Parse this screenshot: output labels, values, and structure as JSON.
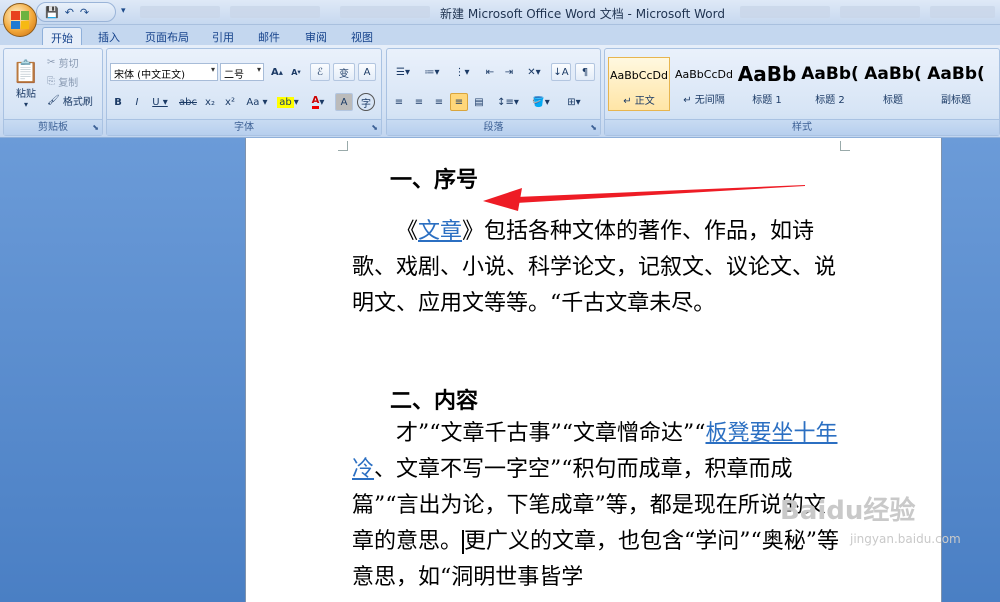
{
  "window": {
    "title": "新建 Microsoft Office Word 文档 - Microsoft Word"
  },
  "tabs": [
    {
      "label": "开始"
    },
    {
      "label": "插入"
    },
    {
      "label": "页面布局"
    },
    {
      "label": "引用"
    },
    {
      "label": "邮件"
    },
    {
      "label": "审阅"
    },
    {
      "label": "视图"
    }
  ],
  "clipboard": {
    "paste": "粘贴",
    "cut": "剪切",
    "copy": "复制",
    "format_painter": "格式刷",
    "label": "剪贴板"
  },
  "font": {
    "name": "宋体 (中文正文)",
    "size": "二号",
    "label": "字体",
    "wen": "变",
    "pinyin": "A"
  },
  "paragraph": {
    "label": "段落"
  },
  "styles": {
    "label": "样式",
    "items": [
      {
        "sample": "AaBbCcDd",
        "name": "↵ 正文"
      },
      {
        "sample": "AaBbCcDd",
        "name": "↵ 无间隔"
      },
      {
        "sample": "AaBb",
        "name": "标题 1"
      },
      {
        "sample": "AaBb(",
        "name": "标题 2"
      },
      {
        "sample": "AaBb(",
        "name": "标题"
      },
      {
        "sample": "AaBb(",
        "name": "副标题"
      }
    ]
  },
  "document": {
    "heading1": "一、序号",
    "p1_pre": "《",
    "p1_link": "文章",
    "p1_rest": "》包括各种文体的著作、作品，如诗歌、戏剧、小说、科学论文，记叙文、议论文、说明文、应用文等等。“千古文章未尽。",
    "heading2": "二、内容",
    "p2_pre": "才”“文章千古事”“文章憎命达”“",
    "p2_link": "板凳要坐十年冷",
    "p2_mid": "、文章不写一字空”“积句而成章，积章而成篇”“言出为论，下笔成章”等，都是现在所说的文章的意思。",
    "p2_after": "更广义的文章，也包含“学问”“奥秘”等意思，如“洞明世事皆学"
  },
  "watermark": {
    "brand": "Baidu经验",
    "url": "jingyan.baidu.com"
  },
  "colors": {
    "arrow": "#ee1c25",
    "link": "#2b6fc2"
  }
}
